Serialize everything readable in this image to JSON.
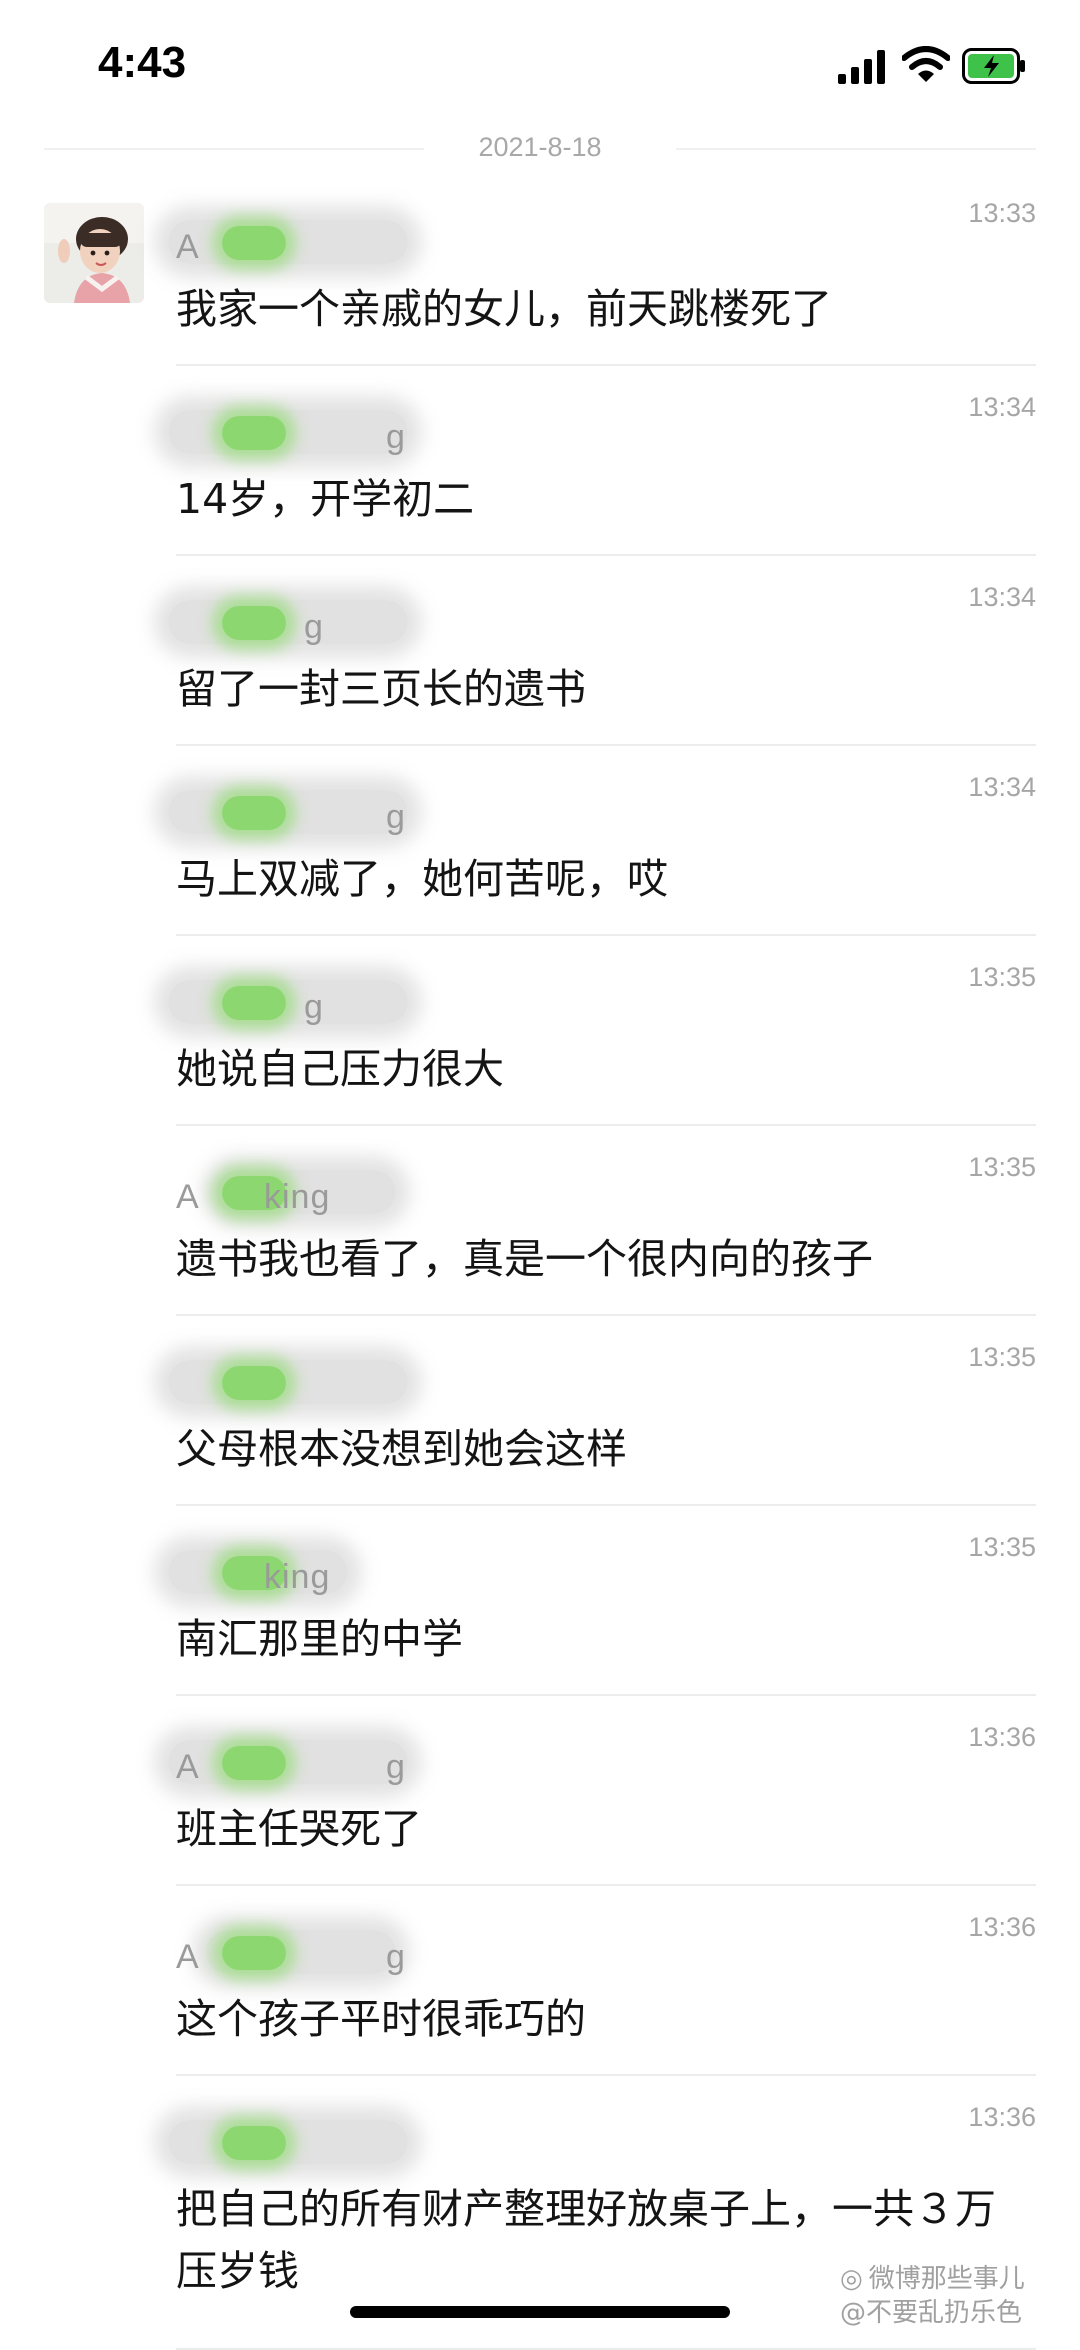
{
  "status_bar": {
    "time": "4:43"
  },
  "date_separator": "2021-8-18",
  "sender_partial": {
    "first": "A",
    "suffix_ing": "ing",
    "suffix_g": "g",
    "suffix_king": "king"
  },
  "messages": [
    {
      "time": "13:33",
      "text": "我家一个亲戚的女儿，前天跳楼死了"
    },
    {
      "time": "13:34",
      "text": "14岁，开学初二"
    },
    {
      "time": "13:34",
      "text": "留了一封三页长的遗书"
    },
    {
      "time": "13:34",
      "text": "马上双减了，她何苦呢，哎"
    },
    {
      "time": "13:35",
      "text": "她说自己压力很大"
    },
    {
      "time": "13:35",
      "text": "遗书我也看了，真是一个很内向的孩子"
    },
    {
      "time": "13:35",
      "text": "父母根本没想到她会这样"
    },
    {
      "time": "13:35",
      "text": "南汇那里的中学"
    },
    {
      "time": "13:36",
      "text": "班主任哭死了"
    },
    {
      "time": "13:36",
      "text": "这个孩子平时很乖巧的"
    },
    {
      "time": "13:36",
      "text": "把自己的所有财产整理好放桌子上，一共３万压岁钱"
    }
  ],
  "watermark": {
    "line1": "微博那些事儿",
    "line2": "@不要乱扔乐色"
  },
  "colors": {
    "blur_green": "#88d66a",
    "divider": "#ececec",
    "meta_text": "#a6a6a6"
  }
}
